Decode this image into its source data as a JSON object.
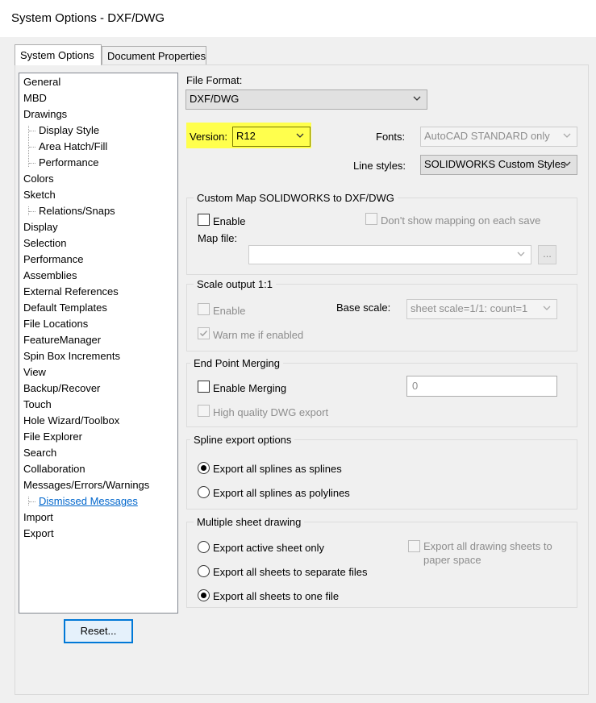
{
  "window": {
    "title": "System Options - DXF/DWG"
  },
  "tabs": [
    {
      "label": "System Options",
      "active": true
    },
    {
      "label": "Document Properties",
      "active": false
    }
  ],
  "tree": [
    {
      "label": "General"
    },
    {
      "label": "MBD"
    },
    {
      "label": "Drawings"
    },
    {
      "label": "Display Style",
      "child": true
    },
    {
      "label": "Area Hatch/Fill",
      "child": true
    },
    {
      "label": "Performance",
      "child": true
    },
    {
      "label": "Colors"
    },
    {
      "label": "Sketch"
    },
    {
      "label": "Relations/Snaps",
      "child": true
    },
    {
      "label": "Display"
    },
    {
      "label": "Selection"
    },
    {
      "label": "Performance"
    },
    {
      "label": "Assemblies"
    },
    {
      "label": "External References"
    },
    {
      "label": "Default Templates"
    },
    {
      "label": "File Locations"
    },
    {
      "label": "FeatureManager"
    },
    {
      "label": "Spin Box Increments"
    },
    {
      "label": "View"
    },
    {
      "label": "Backup/Recover"
    },
    {
      "label": "Touch"
    },
    {
      "label": "Hole Wizard/Toolbox"
    },
    {
      "label": "File Explorer"
    },
    {
      "label": "Search"
    },
    {
      "label": "Collaboration"
    },
    {
      "label": "Messages/Errors/Warnings"
    },
    {
      "label": "Dismissed Messages",
      "child": true,
      "link": true
    },
    {
      "label": "Import"
    },
    {
      "label": "Export"
    }
  ],
  "reset_label": "Reset...",
  "file_format": {
    "label": "File Format:",
    "value": "DXF/DWG"
  },
  "version": {
    "label": "Version:",
    "value": "R12",
    "highlight_color": "#ffff4d"
  },
  "fonts": {
    "label": "Fonts:",
    "value": "AutoCAD STANDARD only"
  },
  "line_styles": {
    "label": "Line styles:",
    "value": "SOLIDWORKS Custom Styles"
  },
  "custom_map": {
    "title": "Custom Map SOLIDWORKS to DXF/DWG",
    "enable_label": "Enable",
    "enable_checked": false,
    "dont_show_label": "Don't show mapping on each save",
    "map_file_label": "Map file:",
    "map_file_value": "",
    "browse_label": "..."
  },
  "scale_output": {
    "title": "Scale output 1:1",
    "enable_label": "Enable",
    "base_scale_label": "Base scale:",
    "base_scale_value": "sheet scale=1/1: count=1",
    "warn_label": "Warn me if enabled",
    "warn_checked": true
  },
  "end_point": {
    "title": "End Point Merging",
    "enable_label": "Enable Merging",
    "value": "0",
    "hq_label": "High quality DWG export"
  },
  "spline": {
    "title": "Spline export options",
    "options": [
      {
        "label": "Export all splines as splines",
        "selected": true
      },
      {
        "label": "Export all splines as polylines",
        "selected": false
      }
    ]
  },
  "multi_sheet": {
    "title": "Multiple sheet drawing",
    "options": [
      {
        "label": "Export active sheet only",
        "selected": false
      },
      {
        "label": "Export all sheets to separate files",
        "selected": false
      },
      {
        "label": "Export all sheets to one file",
        "selected": true
      }
    ],
    "paper_space_label_1": "Export all drawing sheets to",
    "paper_space_label_2": "paper space"
  }
}
